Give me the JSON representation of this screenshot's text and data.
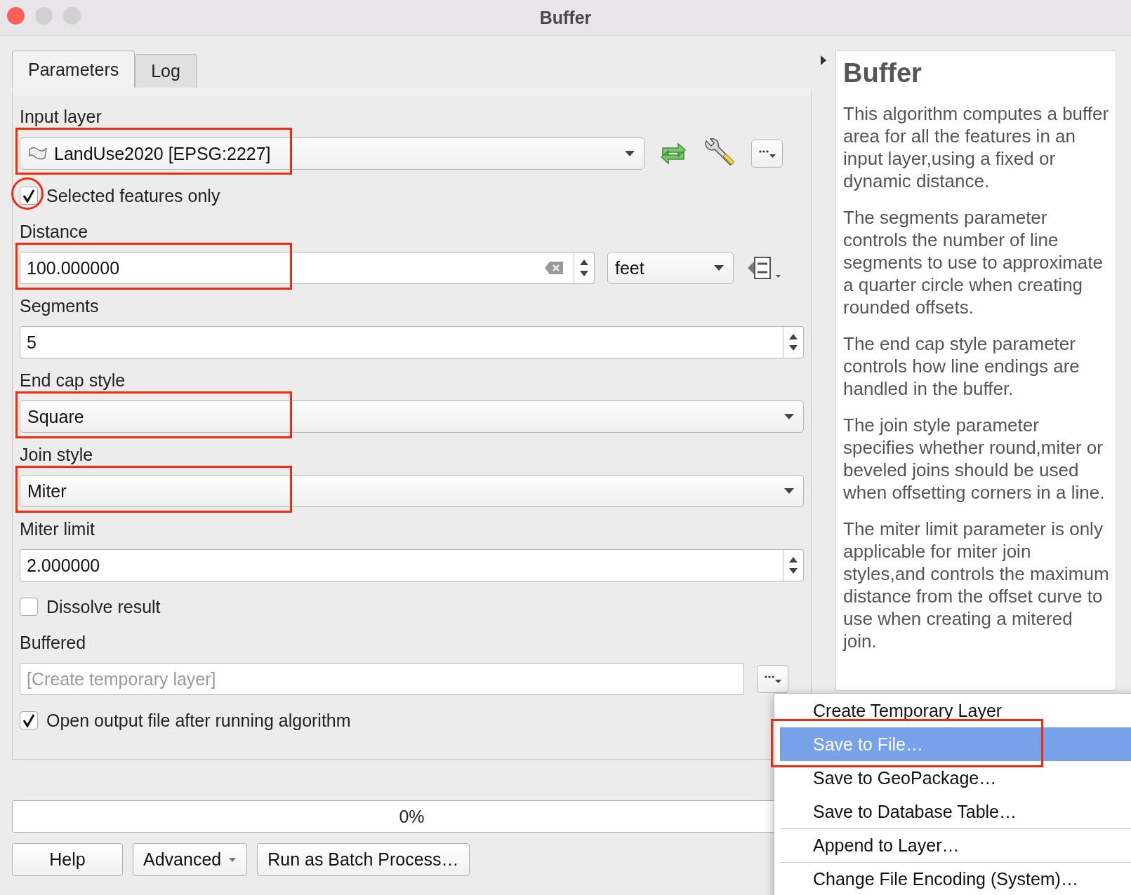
{
  "window": {
    "title": "Buffer"
  },
  "tabs": [
    {
      "label": "Parameters",
      "selected": true
    },
    {
      "label": "Log",
      "selected": false
    }
  ],
  "params": [
    {
      "kind": "layer",
      "label": "Input layer",
      "value": "LandUse2020 [EPSG:2227]",
      "highlighted": true
    },
    {
      "kind": "checkbox",
      "label": "Selected features only",
      "checked": true,
      "circled": true
    },
    {
      "kind": "distance",
      "label": "Distance",
      "value": "100.000000",
      "unit": "feet",
      "highlighted": true
    },
    {
      "kind": "spin",
      "label": "Segments",
      "value": "5",
      "highlighted": false
    },
    {
      "kind": "combo",
      "label": "End cap style",
      "value": "Square",
      "highlighted": true
    },
    {
      "kind": "combo",
      "label": "Join style",
      "value": "Miter",
      "highlighted": true
    },
    {
      "kind": "spin",
      "label": "Miter limit",
      "value": "2.000000",
      "highlighted": false
    },
    {
      "kind": "checkbox",
      "label": "Dissolve result",
      "checked": false,
      "circled": false
    },
    {
      "kind": "output",
      "label": "Buffered",
      "placeholder": "[Create temporary layer]",
      "highlighted": false
    },
    {
      "kind": "checkbox",
      "label": "Open output file after running algorithm",
      "checked": true,
      "circled": false
    }
  ],
  "progress": {
    "level": 0,
    "reading": "0%"
  },
  "buttons": [
    {
      "label": "Help",
      "dropdown": false
    },
    {
      "label": "Advanced",
      "dropdown": true
    },
    {
      "label": "Run as Batch Process…",
      "dropdown": false
    }
  ],
  "help": {
    "title": "Buffer",
    "paragraphs": [
      "This algorithm computes a buffer area for all the features in an input layer,using a fixed or dynamic distance.",
      "The segments parameter controls the number of line segments to use to approximate a quarter circle when creating rounded offsets.",
      "The end cap style parameter controls how line endings are handled in the buffer.",
      "The join style parameter specifies whether round,miter or beveled joins should be used when offsetting corners in a line.",
      "The miter limit parameter is only applicable for miter join styles,and controls the maximum distance from the offset curve to use when creating a mitered join."
    ]
  },
  "menu": [
    {
      "label": "Create Temporary Layer",
      "selected": false,
      "highlighted": false,
      "separator_above": false
    },
    {
      "label": "Save to File…",
      "selected": true,
      "highlighted": true,
      "separator_above": false
    },
    {
      "label": "Save to GeoPackage…",
      "selected": false,
      "highlighted": false,
      "separator_above": false
    },
    {
      "label": "Save to Database Table…",
      "selected": false,
      "highlighted": false,
      "separator_above": false
    },
    {
      "label": "Append to Layer…",
      "selected": false,
      "highlighted": false,
      "separator_above": true
    },
    {
      "label": "Change File Encoding (System)…",
      "selected": false,
      "highlighted": false,
      "separator_above": true
    }
  ]
}
